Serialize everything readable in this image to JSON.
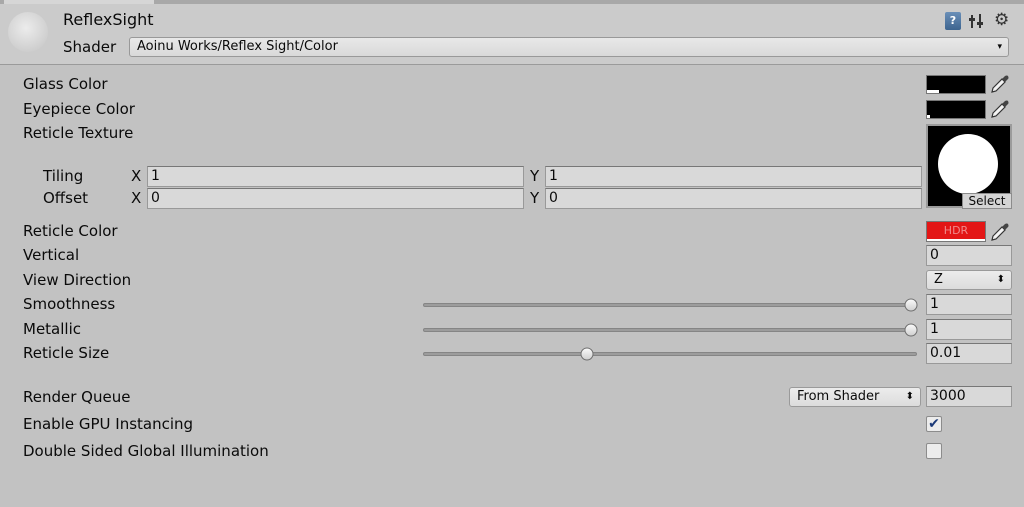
{
  "header": {
    "title": "ReflexSight",
    "shader_label": "Shader",
    "shader_value": "Aoinu Works/Reflex Sight/Color",
    "help_icon": "help-book-icon",
    "preset_icon": "presets-sliders-icon",
    "settings_icon": "gear-icon"
  },
  "properties": {
    "glass_color": {
      "label": "Glass Color",
      "color": "#000000",
      "alpha_fraction": 0.2
    },
    "eyepiece_color": {
      "label": "Eyepiece Color",
      "color": "#000000",
      "alpha_fraction": 0.05
    },
    "reticle_texture": {
      "label": "Reticle Texture",
      "select_label": "Select",
      "tiling_label": "Tiling",
      "offset_label": "Offset",
      "x_label": "X",
      "y_label": "Y",
      "tiling_x": "1",
      "tiling_y": "1",
      "offset_x": "0",
      "offset_y": "0"
    },
    "reticle_color": {
      "label": "Reticle Color",
      "hdr_label": "HDR",
      "color": "#e31616"
    },
    "vertical": {
      "label": "Vertical",
      "value": "0"
    },
    "view_direction": {
      "label": "View Direction",
      "value": "Z"
    },
    "smoothness": {
      "label": "Smoothness",
      "value": "1",
      "min": 0,
      "max": 1,
      "level": 1
    },
    "metallic": {
      "label": "Metallic",
      "value": "1",
      "min": 0,
      "max": 1,
      "level": 1
    },
    "reticle_size": {
      "label": "Reticle Size",
      "value": "0.01",
      "min": 0,
      "max": 0.03,
      "level": 0.01
    }
  },
  "advanced": {
    "render_queue": {
      "label": "Render Queue",
      "mode": "From Shader",
      "value": "3000"
    },
    "gpu_instancing": {
      "label": "Enable GPU Instancing",
      "checked": true,
      "check_glyph": "✔"
    },
    "double_sided_gi": {
      "label": "Double Sided Global Illumination",
      "checked": false,
      "check_glyph": ""
    }
  },
  "glyphs": {
    "dropdown_arrow": "▾",
    "popup_arrow": "⬍",
    "help": "?",
    "gear": "⚙"
  }
}
